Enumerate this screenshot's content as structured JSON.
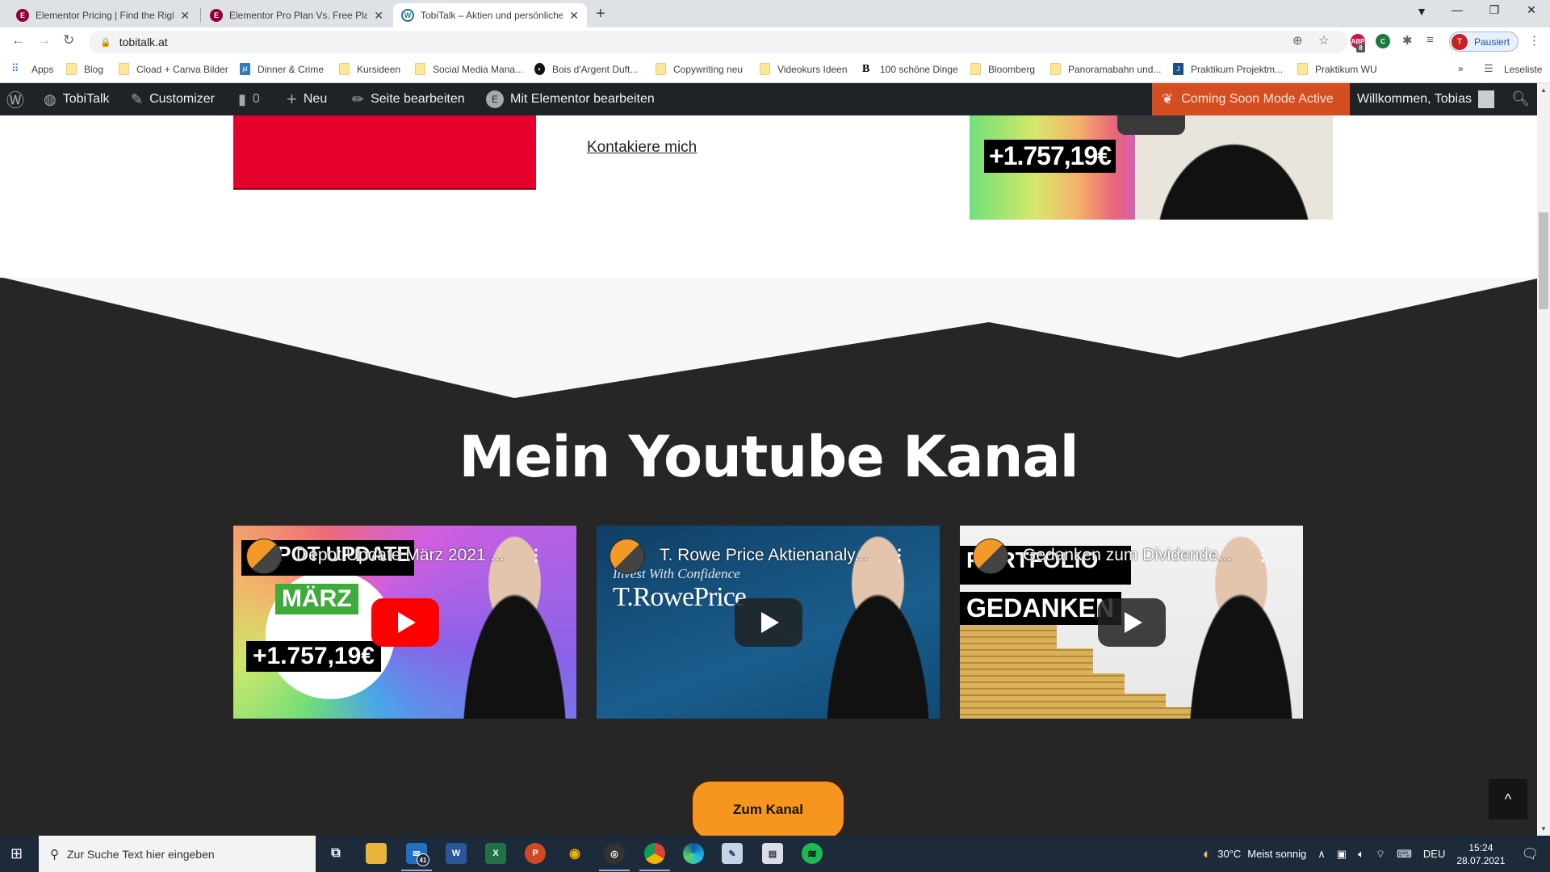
{
  "browser": {
    "tabs": [
      {
        "title": "Elementor Pricing | Find the Righ",
        "favicon": "elementor-icon",
        "active": false
      },
      {
        "title": "Elementor Pro Plan Vs. Free Plan",
        "favicon": "elementor-icon",
        "active": false
      },
      {
        "title": "TobiTalk – Aktien und persönliche",
        "favicon": "wordpress-icon",
        "active": true
      }
    ],
    "new_tab_label": "+",
    "url": "tobitalk.at",
    "profile_initial": "T",
    "profile_status": "Pausiert",
    "extension_badge": "8",
    "bookmarks": [
      {
        "label": "Apps",
        "icon": "apps-grid-icon"
      },
      {
        "label": "Blog",
        "icon": "folder-icon"
      },
      {
        "label": "Cload + Canva Bilder",
        "icon": "folder-icon"
      },
      {
        "label": "Dinner & Crime",
        "icon": "jd-icon"
      },
      {
        "label": "Kursideen",
        "icon": "folder-icon"
      },
      {
        "label": "Social Media Mana...",
        "icon": "folder-icon"
      },
      {
        "label": "Bois d'Argent Duft...",
        "icon": "site-icon"
      },
      {
        "label": "Copywriting neu",
        "icon": "folder-icon"
      },
      {
        "label": "Videokurs Ideen",
        "icon": "folder-icon"
      },
      {
        "label": "100 schöne Dinge",
        "icon": "b-icon"
      },
      {
        "label": "Bloomberg",
        "icon": "folder-icon"
      },
      {
        "label": "Panoramabahn und...",
        "icon": "folder-icon"
      },
      {
        "label": "Praktikum Projektm...",
        "icon": "j-icon"
      },
      {
        "label": "Praktikum WU",
        "icon": "folder-icon"
      }
    ],
    "bookmarks_overflow": "»",
    "reading_list": "Leseliste"
  },
  "wp_admin_bar": {
    "site_name": "TobiTalk",
    "customizer": "Customizer",
    "comments_count": "0",
    "new_label": "Neu",
    "edit_page": "Seite bearbeiten",
    "edit_elementor": "Mit Elementor bearbeiten",
    "coming_soon": "Coming Soon Mode Active",
    "welcome": "Willkommen, Tobias",
    "coming_soon_color": "#d54e21"
  },
  "page": {
    "contact_link": "Kontakiere mich",
    "top_thumbnail_amount": "+1.757,19€",
    "section_heading": "Mein Youtube Kanal",
    "videos": [
      {
        "title": "Depot Update März 2021 ...",
        "thumb_text_1": "DEPOT UPDATE",
        "thumb_text_2": "MÄRZ",
        "thumb_text_3": "+1.757,19€"
      },
      {
        "title": "T. Rowe Price Aktienanaly...",
        "thumb_text_1": "Invest With Confidence",
        "thumb_text_2": "T.RowePrice"
      },
      {
        "title": "Gedanken zum Dividende...",
        "thumb_text_1": "PORTFOLIO",
        "thumb_text_2": "GEDANKEN"
      }
    ],
    "channel_button": "Zum Kanal",
    "button_color": "#f7961e",
    "scroll_top_icon": "^"
  },
  "taskbar": {
    "search_placeholder": "Zur Suche Text hier eingeben",
    "mail_badge": "41",
    "weather_temp": "30°C",
    "weather_text": "Meist sonnig",
    "language": "DEU",
    "time": "15:24",
    "date": "28.07.2021"
  }
}
